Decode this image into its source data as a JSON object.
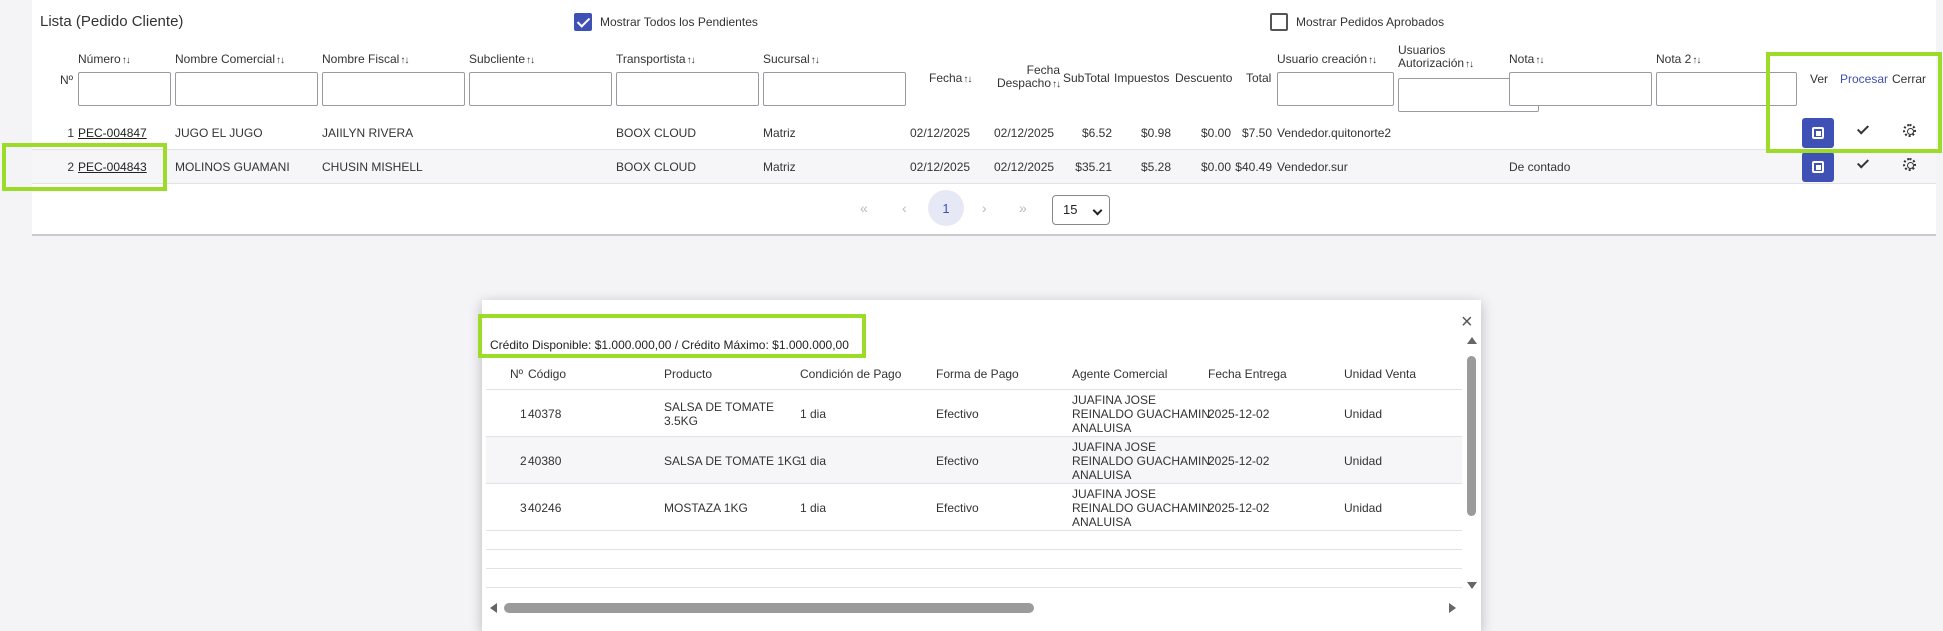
{
  "list": {
    "title": "Lista (Pedido Cliente)",
    "show_pending_label": "Mostrar Todos los Pendientes",
    "show_pending_checked": true,
    "show_approved_label": "Mostrar Pedidos Aprobados",
    "show_approved_checked": false,
    "sort_glyph": "↑↓",
    "headers": {
      "row_no": "Nº",
      "numero": "Número",
      "nombre_comercial": "Nombre Comercial",
      "nombre_fiscal": "Nombre Fiscal",
      "subcliente": "Subcliente",
      "transportista": "Transportista",
      "sucursal": "Sucursal",
      "fecha": "Fecha",
      "fecha_despacho_1": "Fecha",
      "fecha_despacho_2": "Despacho",
      "subtotal": "SubTotal",
      "impuestos": "Impuestos",
      "descuento": "Descuento",
      "total": "Total",
      "usuario_creacion": "Usuario creación",
      "usuarios_aut_1": "Usuarios",
      "usuarios_aut_2": "Autorización",
      "nota": "Nota",
      "nota2": "Nota 2",
      "ver": "Ver",
      "procesar": "Procesar",
      "cerrar": "Cerrar"
    },
    "rows": [
      {
        "n": "1",
        "numero": "PEC-004847",
        "nombre_comercial": "JUGO EL JUGO",
        "nombre_fiscal": "JAIILYN RIVERA",
        "subcliente": "",
        "transportista": "BOOX CLOUD",
        "sucursal": "Matriz",
        "fecha": "02/12/2025",
        "fecha_despacho": "02/12/2025",
        "subtotal": "$6.52",
        "impuestos": "$0.98",
        "descuento": "$0.00",
        "total": "$7.50",
        "usuario_creacion": "Vendedor.quitonorte2",
        "usuarios_aut": "",
        "nota": "",
        "nota2": ""
      },
      {
        "n": "2",
        "numero": "PEC-004843",
        "nombre_comercial": "MOLINOS GUAMANI",
        "nombre_fiscal": "CHUSIN MISHELL",
        "subcliente": "",
        "transportista": "BOOX CLOUD",
        "sucursal": "Matriz",
        "fecha": "02/12/2025",
        "fecha_despacho": "02/12/2025",
        "subtotal": "$35.21",
        "impuestos": "$5.28",
        "descuento": "$0.00",
        "total": "$40.49",
        "usuario_creacion": "Vendedor.sur",
        "usuarios_aut": "",
        "nota": "De contado",
        "nota2": ""
      }
    ],
    "pagination": {
      "first": "«",
      "prev": "‹",
      "current": "1",
      "next": "›",
      "last": "»",
      "page_size": "15"
    }
  },
  "modal": {
    "credit_text": "Crédito Disponible: $1.000.000,00 / Crédito Máximo: $1.000.000,00",
    "close_glyph": "×",
    "headers": {
      "no": "Nº",
      "codigo": "Código",
      "producto": "Producto",
      "condicion_pago": "Condición de Pago",
      "forma_pago": "Forma de Pago",
      "agente": "Agente Comercial",
      "fecha_entrega": "Fecha Entrega",
      "unidad_venta": "Unidad Venta"
    },
    "rows": [
      {
        "n": "1",
        "codigo": "40378",
        "producto_1": "SALSA DE TOMATE",
        "producto_2": "3.5KG",
        "condicion": "1 dia",
        "forma": "Efectivo",
        "agente_1": "JUAFINA JOSE",
        "agente_2": "REINALDO GUACHAMIN",
        "agente_3": "ANALUISA",
        "fecha_entrega": "2025-12-02",
        "unidad": "Unidad"
      },
      {
        "n": "2",
        "codigo": "40380",
        "producto_1": "SALSA DE TOMATE 1KG",
        "producto_2": "",
        "condicion": "1 dia",
        "forma": "Efectivo",
        "agente_1": "JUAFINA JOSE",
        "agente_2": "REINALDO GUACHAMIN",
        "agente_3": "ANALUISA",
        "fecha_entrega": "2025-12-02",
        "unidad": "Unidad"
      },
      {
        "n": "3",
        "codigo": "40246",
        "producto_1": "MOSTAZA 1KG",
        "producto_2": "",
        "condicion": "1 dia",
        "forma": "Efectivo",
        "agente_1": "JUAFINA JOSE",
        "agente_2": "REINALDO GUACHAMIN",
        "agente_3": "ANALUISA",
        "fecha_entrega": "2025-12-02",
        "unidad": "Unidad"
      }
    ]
  },
  "colors": {
    "accent": "#3f51b5",
    "highlight": "#9cdc28"
  }
}
